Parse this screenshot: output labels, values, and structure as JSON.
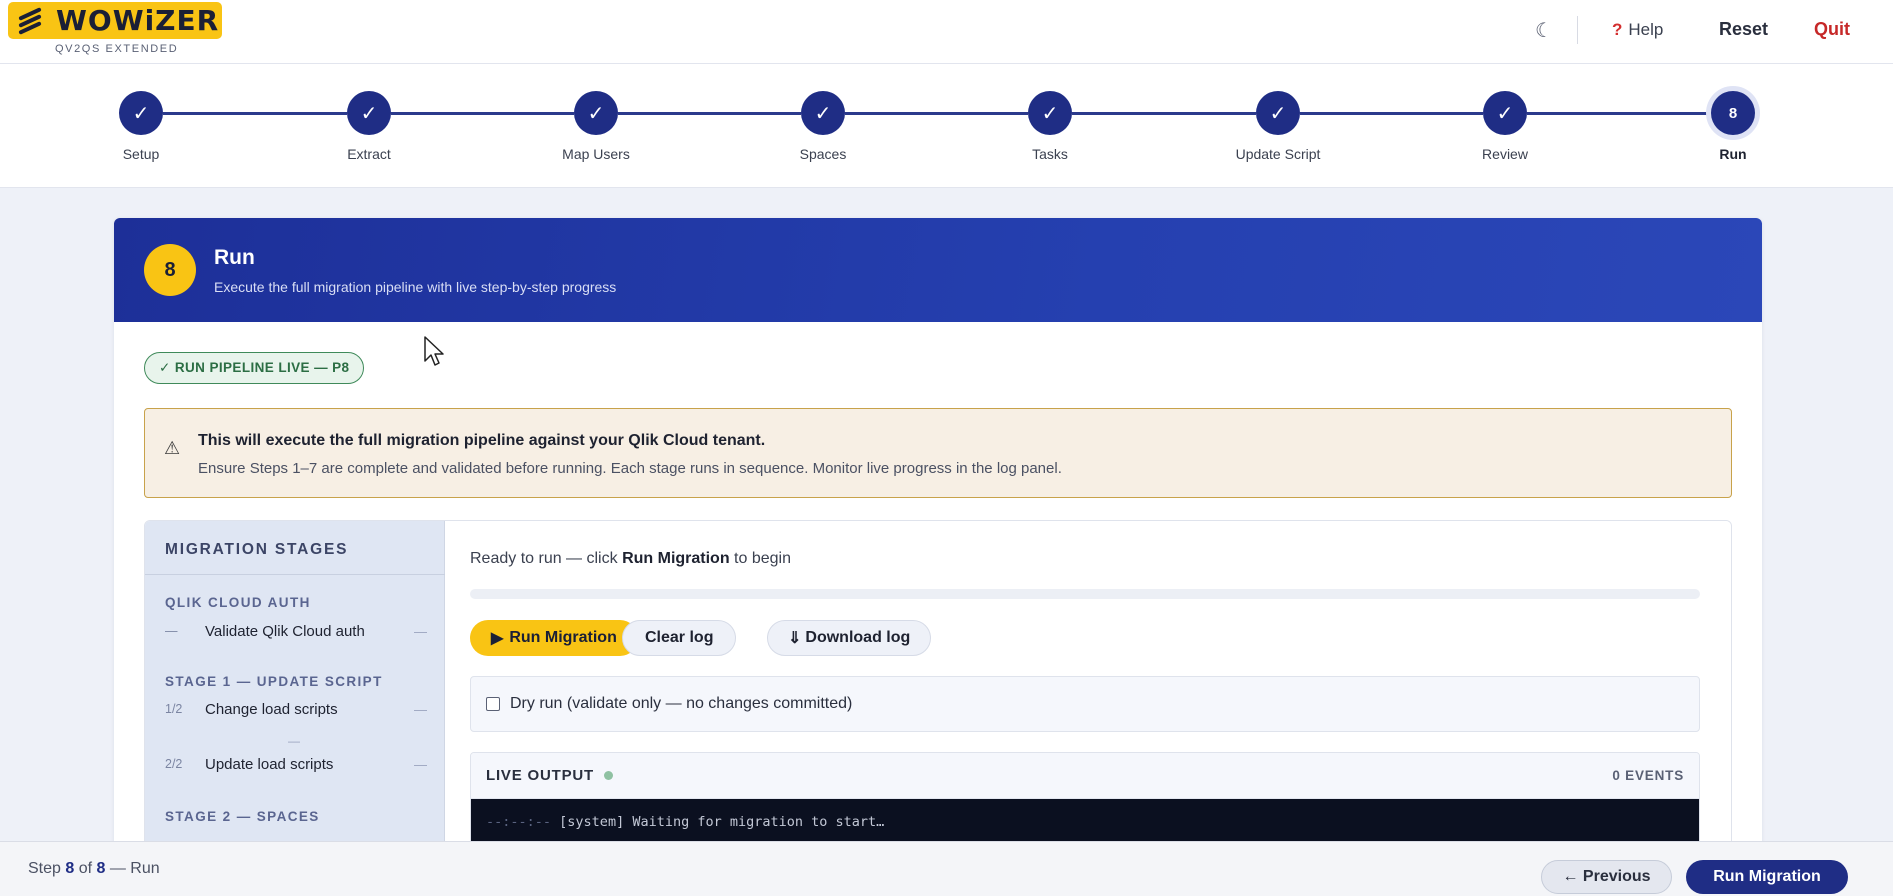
{
  "header": {
    "logo_text": "WOWiZER",
    "logo_sub": "QV2QS EXTENDED",
    "theme_icon": "moon-icon",
    "help_label": "Help",
    "reset_label": "Reset",
    "quit_label": "Quit"
  },
  "stepper": {
    "steps": [
      {
        "label": "Setup",
        "mark": "✓"
      },
      {
        "label": "Extract",
        "mark": "✓"
      },
      {
        "label": "Map Users",
        "mark": "✓"
      },
      {
        "label": "Spaces",
        "mark": "✓"
      },
      {
        "label": "Tasks",
        "mark": "✓"
      },
      {
        "label": "Update Script",
        "mark": "✓"
      },
      {
        "label": "Review",
        "mark": "✓"
      },
      {
        "label": "Run",
        "mark": "8"
      }
    ]
  },
  "card": {
    "number": "8",
    "title": "Run",
    "subtitle": "Execute the full migration pipeline with live step-by-step progress",
    "badge": "✓ RUN PIPELINE LIVE — P8",
    "warning_title": "This will execute the full migration pipeline against your Qlik Cloud tenant.",
    "warning_text": "Ensure Steps 1–7 are complete and validated before running. Each stage runs in sequence. Monitor live progress in the log panel."
  },
  "stages": {
    "title": "MIGRATION STAGES",
    "groups": [
      {
        "label": "QLIK CLOUD AUTH",
        "items": [
          {
            "idx": "—",
            "name": "Validate Qlik Cloud auth",
            "status": "—"
          }
        ]
      },
      {
        "label": "STAGE 1 — UPDATE SCRIPT",
        "items": [
          {
            "idx": "1/2",
            "name": "Change load scripts",
            "status": "—"
          },
          {
            "idx": "2/2",
            "name": "Update load scripts",
            "status": "—"
          }
        ]
      },
      {
        "label": "STAGE 2 — SPACES",
        "items": []
      }
    ],
    "between_dash": "—"
  },
  "runner": {
    "ready_prefix": "Ready to run — click ",
    "ready_bold": "Run Migration",
    "ready_suffix": " to begin",
    "progress": 0,
    "run_label": "Run Migration",
    "clear_label": "Clear log",
    "download_label": "Download log",
    "dry_run_label": "Dry run (validate only — no changes committed)",
    "dry_run_checked": false,
    "live_title": "LIVE OUTPUT",
    "events": "0 EVENTS",
    "log_time": "--:--:--",
    "log_text": "[system] Waiting for migration to start…"
  },
  "footer": {
    "step_prefix": "Step ",
    "step_current": "8",
    "step_of": " of ",
    "step_total": "8",
    "step_name": "Run",
    "prev_label": "← Previous",
    "next_label": "Run Migration"
  },
  "colors": {
    "brand_yellow": "#f9c414",
    "brand_navy": "#1f2d85",
    "quit_red": "#c62828"
  }
}
